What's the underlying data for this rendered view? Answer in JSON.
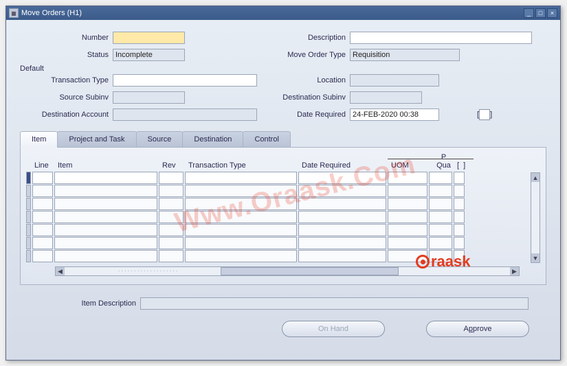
{
  "window": {
    "title": "Move Orders (H1)"
  },
  "header": {
    "number_label": "Number",
    "number_value": "",
    "description_label": "Description",
    "description_value": "",
    "status_label": "Status",
    "status_value": "Incomplete",
    "move_order_type_label": "Move Order Type",
    "move_order_type_value": "Requisition"
  },
  "default_group": {
    "legend": "Default",
    "transaction_type_label": "Transaction Type",
    "transaction_type_value": "",
    "location_label": "Location",
    "location_value": "",
    "source_subinv_label": "Source Subinv",
    "source_subinv_value": "",
    "dest_subinv_label": "Destination Subinv",
    "dest_subinv_value": "",
    "dest_account_label": "Destination Account",
    "dest_account_value": "",
    "date_required_label": "Date Required",
    "date_required_value": "24-FEB-2020 00:38"
  },
  "tabs": {
    "item": "Item",
    "project": "Project and Task",
    "source": "Source",
    "destination": "Destination",
    "control": "Control"
  },
  "grid": {
    "columns": {
      "line": "Line",
      "item": "Item",
      "rev": "Rev",
      "ttype": "Transaction Type",
      "dreq": "Date Required",
      "uom": "UOM",
      "p": "P",
      "qua": "Qua"
    }
  },
  "footer": {
    "item_desc_label": "Item Description",
    "item_desc_value": "",
    "onhand_btn": "On Hand",
    "approve_btn_pre": "A",
    "approve_btn_ul": "p",
    "approve_btn_post": "prove"
  },
  "watermark": "Www.Oraask.Com",
  "logo_text": "raask"
}
